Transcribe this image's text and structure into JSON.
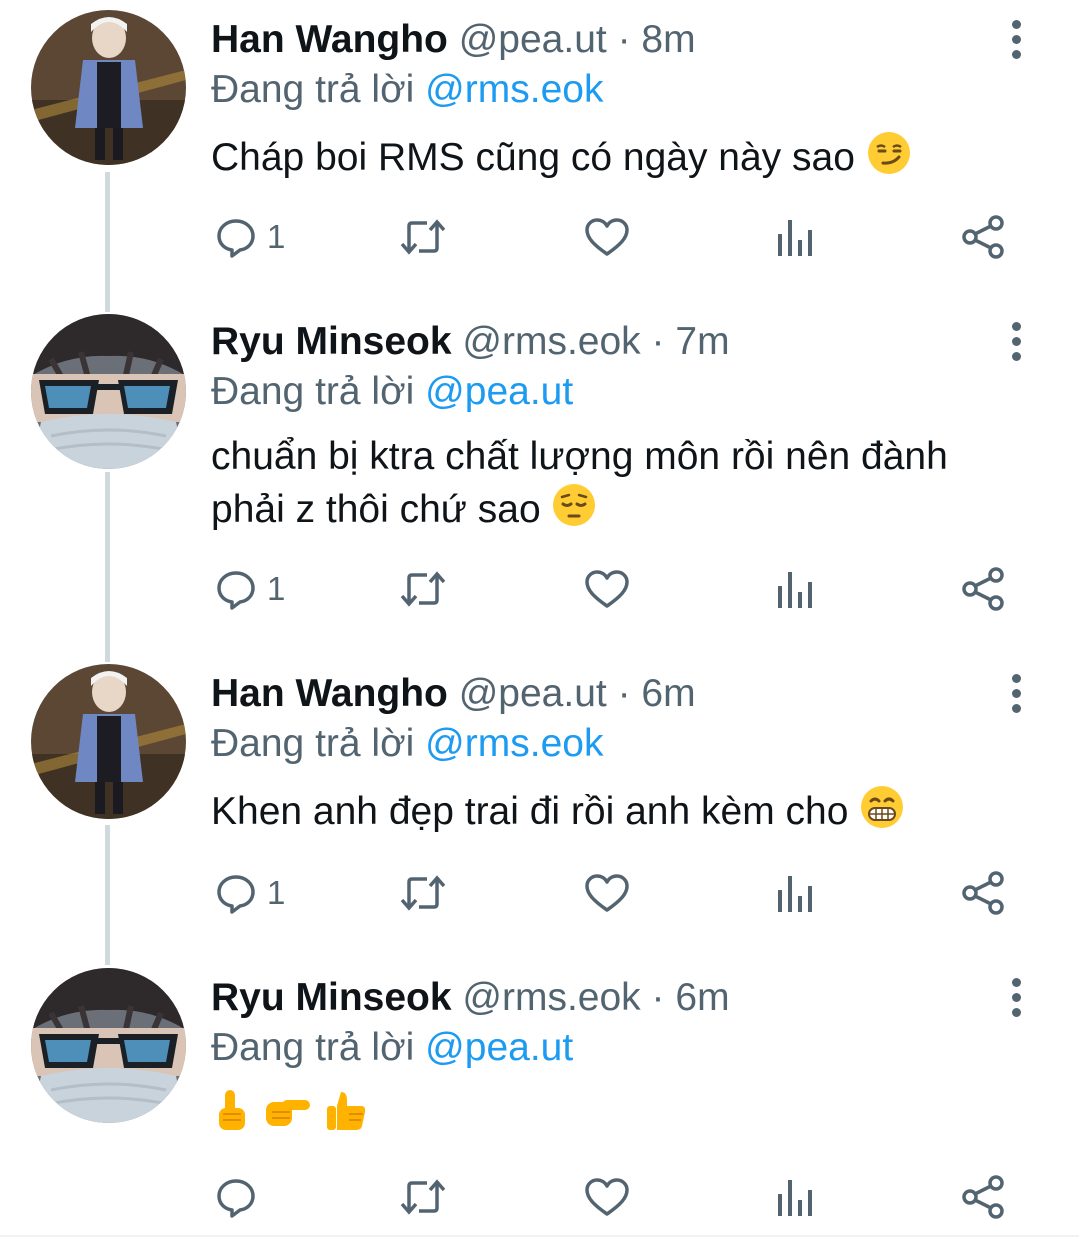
{
  "replying_prefix": "Đang trả lời",
  "colors": {
    "link": "#1d9bf0",
    "muted": "#536471",
    "text": "#0f1419",
    "thread": "#cfd9de"
  },
  "tweets": [
    {
      "name": "Han Wangho",
      "handle": "@pea.ut",
      "dot": "·",
      "time": "8m",
      "reply_to": "@rms.eok",
      "text_lines": [
        "Cháp boi RMS cũng có ngày này sao"
      ],
      "emoji": "smirking-face",
      "reply_count": "1",
      "avatar": "han-wangho-avatar"
    },
    {
      "name": "Ryu Minseok",
      "handle": "@rms.eok",
      "dot": "·",
      "time": "7m",
      "reply_to": "@pea.ut",
      "text_lines": [
        "chuẩn bị ktra chất lượng môn rồi nên đành",
        "phải z thôi chứ sao"
      ],
      "emoji": "pensive-face",
      "reply_count": "1",
      "avatar": "ryu-minseok-avatar"
    },
    {
      "name": "Han Wangho",
      "handle": "@pea.ut",
      "dot": "·",
      "time": "6m",
      "reply_to": "@rms.eok",
      "text_lines": [
        "Khen anh đẹp trai đi rồi anh kèm cho"
      ],
      "emoji": "grinning-face",
      "reply_count": "1",
      "avatar": "han-wangho-avatar"
    },
    {
      "name": "Ryu Minseok",
      "handle": "@rms.eok",
      "dot": "·",
      "time": "6m",
      "reply_to": "@pea.ut",
      "text_lines": [
        ""
      ],
      "emoji": "finger-up-point-right-thumbs-up",
      "reply_count": "",
      "avatar": "ryu-minseok-avatar"
    }
  ],
  "icons": [
    "reply-icon",
    "retweet-icon",
    "like-icon",
    "analytics-icon",
    "share-icon",
    "more-icon"
  ]
}
